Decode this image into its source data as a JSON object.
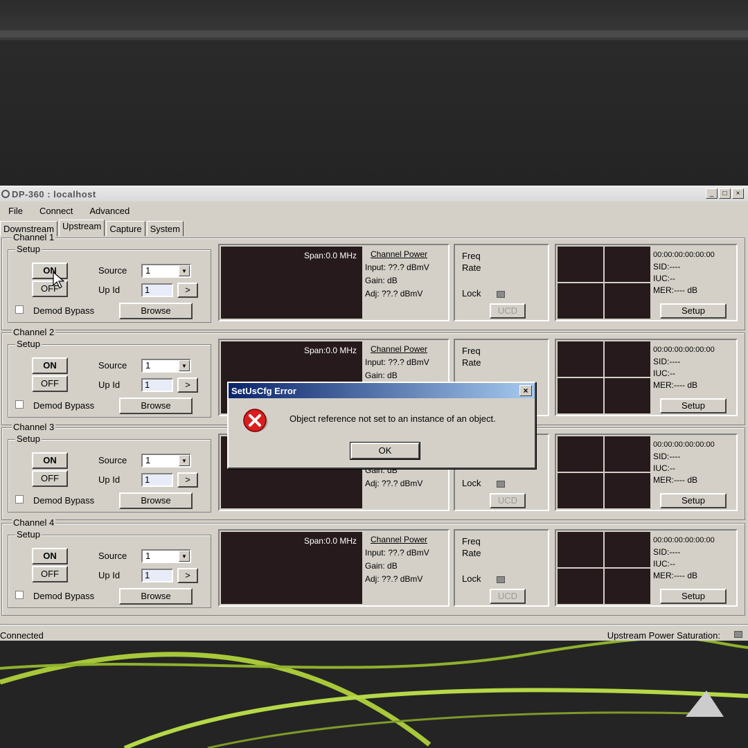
{
  "window": {
    "title": "DP-360 : localhost",
    "buttons": [
      "_",
      "□",
      "×"
    ]
  },
  "menu": [
    "File",
    "Connect",
    "Advanced"
  ],
  "tabs": [
    {
      "label": "Downstream",
      "active": false
    },
    {
      "label": "Upstream",
      "active": true
    },
    {
      "label": "Capture",
      "active": false
    },
    {
      "label": "System",
      "active": false
    }
  ],
  "labels": {
    "setup": "Setup",
    "on": "ON",
    "off": "OFF",
    "source": "Source",
    "up_id": "Up Id",
    "go": ">",
    "demod_bypass": "Demod Bypass",
    "browse": "Browse",
    "span": "Span:0.0 MHz",
    "channel_power": "Channel Power",
    "input": "Input: ??.? dBmV",
    "gain": "Gain: dB",
    "adj": "Adj: ??.? dBmV",
    "freq": "Freq",
    "rate": "Rate",
    "lock": "Lock",
    "ucd": "UCD",
    "mac": "00:00:00:00:00:00",
    "sid": "SID:----",
    "iuc": "IUC:--",
    "mer": "MER:---- dB",
    "setup_btn": "Setup",
    "chevron": "▼"
  },
  "channels": [
    {
      "name": "Channel 1",
      "source": "1",
      "up_id": "1"
    },
    {
      "name": "Channel 2",
      "source": "1",
      "up_id": "1"
    },
    {
      "name": "Channel 3",
      "source": "1",
      "up_id": "1"
    },
    {
      "name": "Channel 4",
      "source": "1",
      "up_id": "1"
    }
  ],
  "status": {
    "left": "Connected",
    "right": "Upstream Power Saturation:"
  },
  "dialog": {
    "title": "SetUsCfg Error",
    "close": "×",
    "message": "Object reference not set to an instance of an object.",
    "ok": "OK",
    "icon": "error-icon"
  }
}
